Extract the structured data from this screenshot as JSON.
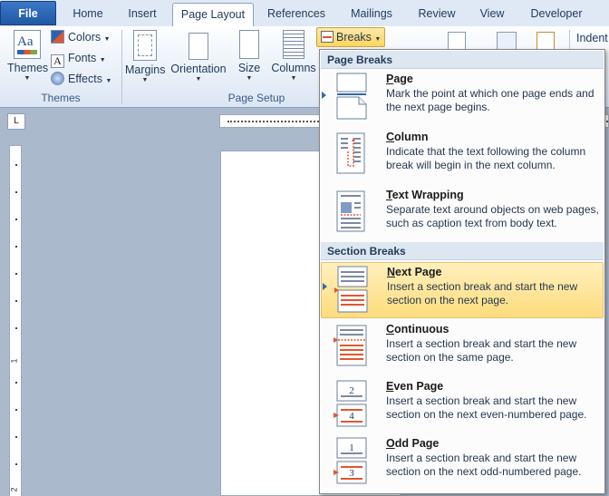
{
  "tabs": [
    {
      "label": "File",
      "key": "file"
    },
    {
      "label": "Home",
      "key": "home"
    },
    {
      "label": "Insert",
      "key": "insert"
    },
    {
      "label": "Page Layout",
      "key": "page-layout"
    },
    {
      "label": "References",
      "key": "references"
    },
    {
      "label": "Mailings",
      "key": "mailings"
    },
    {
      "label": "Review",
      "key": "review"
    },
    {
      "label": "View",
      "key": "view"
    },
    {
      "label": "Developer",
      "key": "developer"
    }
  ],
  "ribbon": {
    "themes": {
      "themes_label": "Themes",
      "colors_label": "Colors",
      "fonts_label": "Fonts",
      "effects_label": "Effects",
      "group_label": "Themes"
    },
    "page_setup": {
      "margins_label": "Margins",
      "orientation_label": "Orientation",
      "size_label": "Size",
      "columns_label": "Columns",
      "breaks_label": "Breaks",
      "group_label": "Page Setup"
    },
    "indent_label": "Indent"
  },
  "ruler": {
    "corner_symbol": "L",
    "vertical_numbers": [
      "1",
      "2"
    ]
  },
  "breaks_menu": {
    "page_breaks_header": "Page Breaks",
    "section_breaks_header": "Section Breaks",
    "items": [
      {
        "key": "page",
        "title_underline": "P",
        "title_rest": "age",
        "description": "Mark the point at which one page ends and the next page begins."
      },
      {
        "key": "column",
        "title_underline": "C",
        "title_rest": "olumn",
        "description": "Indicate that the text following the column break will begin in the next column."
      },
      {
        "key": "text-wrapping",
        "title_underline": "T",
        "title_rest": "ext Wrapping",
        "description": "Separate text around objects on web pages, such as caption text from body text."
      },
      {
        "key": "next-page",
        "title_underline": "N",
        "title_rest": "ext Page",
        "description": "Insert a section break and start the new section on the next page.",
        "highlighted": true
      },
      {
        "key": "continuous",
        "title_underline": "C",
        "title_rest": "ontinuous",
        "description": "Insert a section break and start the new section on the same page."
      },
      {
        "key": "even-page",
        "title_underline": "E",
        "title_rest": "ven Page",
        "description": "Insert a section break and start the new section on the next even-numbered page.",
        "icon_numbers": [
          "2",
          "4"
        ]
      },
      {
        "key": "odd-page",
        "title_underline": "O",
        "title_rest": "dd Page",
        "description": "Insert a section break and start the new section on the next odd-numbered page.",
        "icon_numbers": [
          "1",
          "3"
        ]
      }
    ]
  },
  "colors": {
    "accent_highlight": "#fedc7c",
    "file_tab": "#2a63b4",
    "break_marker": "#e2562c"
  }
}
